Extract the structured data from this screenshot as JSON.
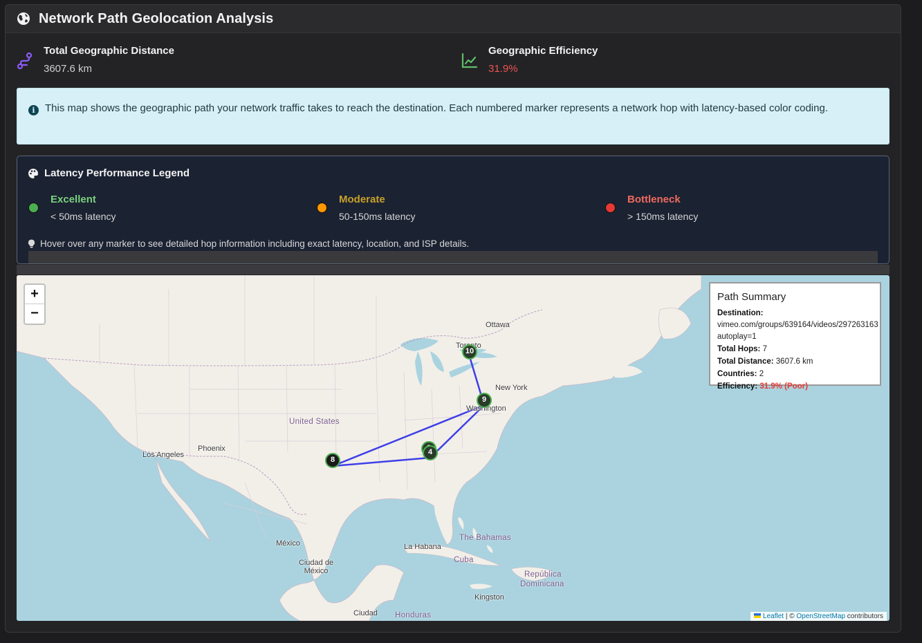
{
  "header": {
    "title": "Network Path Geolocation Analysis",
    "icon": "globe-icon"
  },
  "stats": {
    "distance": {
      "label": "Total Geographic Distance",
      "value": "3607.6 km",
      "icon": "route-icon"
    },
    "efficiency": {
      "label": "Geographic Efficiency",
      "value": "31.9%",
      "icon": "chart-line-icon"
    }
  },
  "info": {
    "text": "This map shows the geographic path your network traffic takes to reach the destination. Each numbered marker represents a network hop with latency-based color coding."
  },
  "legend": {
    "title": "Latency Performance Legend",
    "items": [
      {
        "name": "Excellent",
        "desc": "< 50ms latency",
        "color": "#4caf50",
        "text_color": "#7bd27f"
      },
      {
        "name": "Moderate",
        "desc": "50-150ms latency",
        "color": "#ff9800",
        "text_color": "#c8a12a"
      },
      {
        "name": "Bottleneck",
        "desc": "> 150ms latency",
        "color": "#e53935",
        "text_color": "#f06a5f"
      }
    ],
    "tip": "Hover over any marker to see detailed hop information including exact latency, location, and ISP details."
  },
  "map": {
    "zoom_in": "+",
    "zoom_out": "−",
    "cities": [
      "Ottawa",
      "Toronto",
      "New York",
      "Washington",
      "Phoenix",
      "Los Angeles",
      "México",
      "Ciudad de México",
      "La Habana",
      "Cuba",
      "Kingston",
      "Ciudad",
      "Honduras",
      "República",
      "Dominicana"
    ],
    "countries": [
      "United States",
      "The Bahamas"
    ],
    "markers": [
      "10",
      "9",
      "8",
      "3",
      "4"
    ],
    "attribution": {
      "leaflet": "Leaflet",
      "sep": "| ©",
      "osm": "OpenStreetMap",
      "tail": "contributors"
    }
  },
  "summary": {
    "title": "Path Summary",
    "destination_label": "Destination:",
    "destination_value": "vimeo.com/groups/639164/videos/297263163",
    "destination_value2": "autoplay=1",
    "hops_label": "Total Hops:",
    "hops_value": "7",
    "distance_label": "Total Distance:",
    "distance_value": "3607.6 km",
    "countries_label": "Countries:",
    "countries_value": "2",
    "efficiency_label": "Efficiency:",
    "efficiency_value": "31.9% (Poor)"
  }
}
